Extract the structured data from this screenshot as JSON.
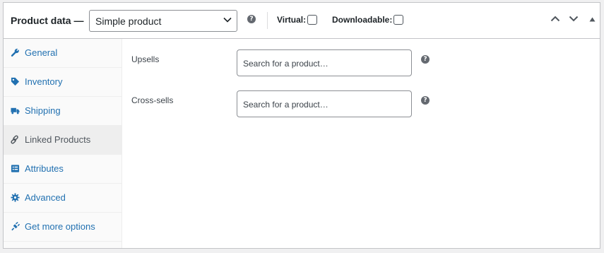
{
  "header": {
    "title": "Product data —",
    "product_type": {
      "selected": "Simple product"
    },
    "help_icon": "question-circle-icon",
    "virtual_label": "Virtual:",
    "virtual_checked": false,
    "downloadable_label": "Downloadable:",
    "downloadable_checked": false,
    "controls": [
      "chevron-up-icon",
      "chevron-down-icon",
      "triangle-up-icon"
    ]
  },
  "sidebar": {
    "items": [
      {
        "label": "General",
        "icon": "wrench-icon",
        "active": false
      },
      {
        "label": "Inventory",
        "icon": "tag-icon",
        "active": false
      },
      {
        "label": "Shipping",
        "icon": "truck-icon",
        "active": false
      },
      {
        "label": "Linked Products",
        "icon": "link-icon",
        "active": true
      },
      {
        "label": "Attributes",
        "icon": "list-icon",
        "active": false
      },
      {
        "label": "Advanced",
        "icon": "gear-icon",
        "active": false
      },
      {
        "label": "Get more options",
        "icon": "plugin-icon",
        "active": false
      }
    ]
  },
  "main": {
    "upsells": {
      "label": "Upsells",
      "placeholder": "Search for a product…"
    },
    "cross_sells": {
      "label": "Cross-sells",
      "placeholder": "Search for a product…"
    }
  },
  "colors": {
    "link": "#2271b1",
    "active_tab_bg": "#eeeeee",
    "border": "#c3c4c7",
    "help_icon": "#646970"
  }
}
